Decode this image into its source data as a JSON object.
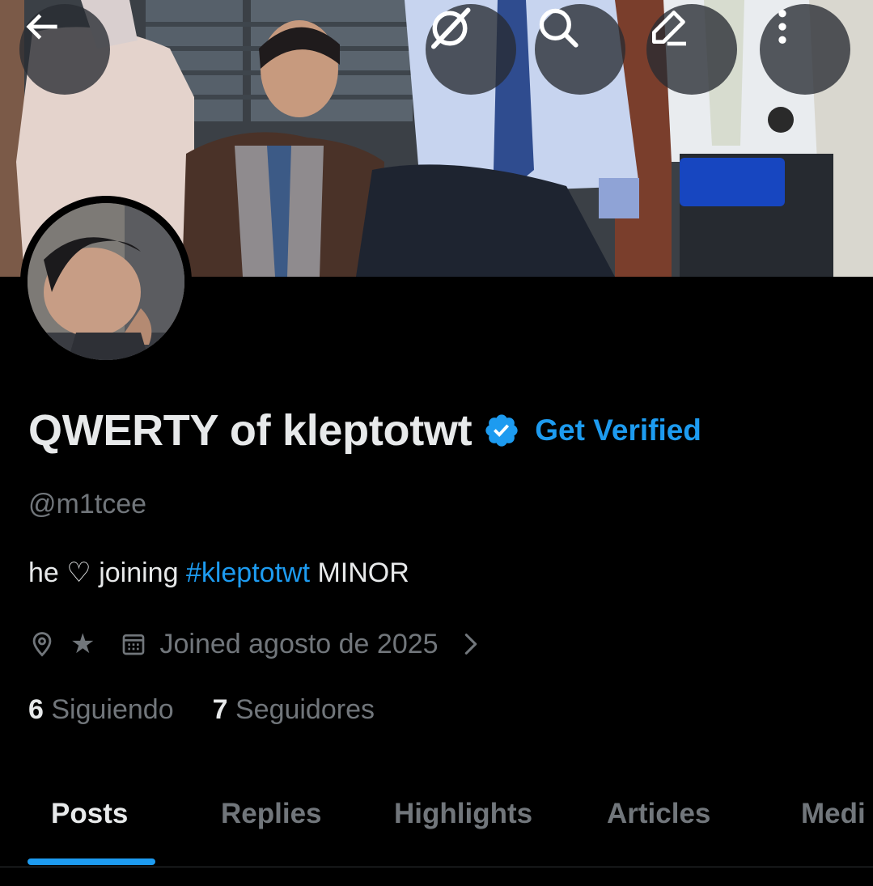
{
  "header": {
    "back_icon": "arrow-left-icon",
    "grok_icon": "grok-slash-icon",
    "search_icon": "search-icon",
    "edit_icon": "pencil-icon",
    "more_icon": "more-vertical-icon"
  },
  "profile": {
    "display_name": "QWERTY of kleptotwt",
    "verified_icon": "verified-badge-icon",
    "get_verified_label": "Get Verified",
    "handle": "@m1tcee",
    "bio_prefix": "he ♡ joining ",
    "bio_hashtag": "#kleptotwt",
    "bio_suffix": " MINOR",
    "location_icon": "location-pin-icon",
    "location_text": "★",
    "joined_icon": "calendar-icon",
    "joined_text": "Joined agosto de 2025",
    "joined_chevron_icon": "chevron-right-icon",
    "following_count": "6",
    "following_label": " Siguiendo",
    "followers_count": "7",
    "followers_label": " Seguidores"
  },
  "tabs": [
    {
      "label": "Posts",
      "active": true
    },
    {
      "label": "Replies",
      "active": false
    },
    {
      "label": "Highlights",
      "active": false
    },
    {
      "label": "Articles",
      "active": false
    },
    {
      "label": "Medi",
      "active": false
    }
  ],
  "colors": {
    "accent": "#1d9bf0",
    "background": "#000000",
    "primary_text": "#e7e9ea",
    "secondary_text": "#71767b"
  }
}
